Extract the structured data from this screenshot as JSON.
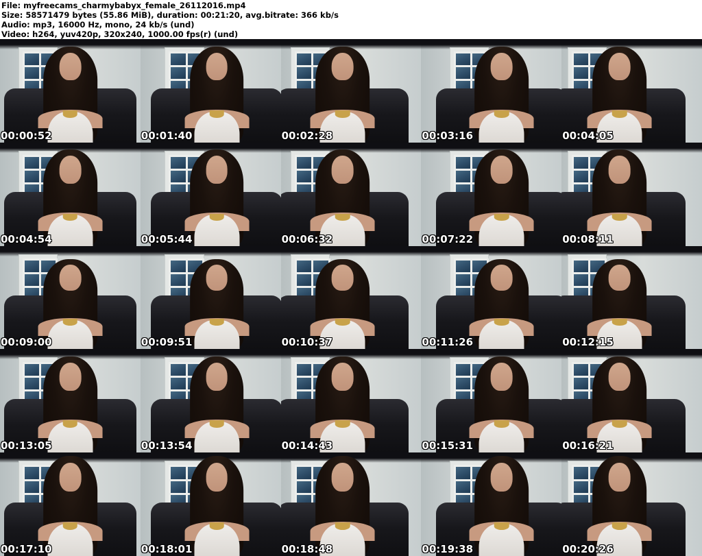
{
  "header": {
    "lines": [
      "File: myfreecams_charmybabyx_female_26112016.mp4",
      "Size: 58571479 bytes (55.86 MiB), duration: 00:21:20, avg.bitrate: 366 kb/s",
      "Audio: mp3, 16000 Hz, mono, 24 kb/s (und)",
      "Video: h264, yuv420p, 320x240, 1000.00 fps(r) (und)"
    ]
  },
  "thumbnails": {
    "rows": 5,
    "columns": 5,
    "timestamps": [
      "00:00:52",
      "00:01:40",
      "00:02:28",
      "00:03:16",
      "00:04:05",
      "00:04:54",
      "00:05:44",
      "00:06:32",
      "00:07:22",
      "00:08:11",
      "00:09:00",
      "00:09:51",
      "00:10:37",
      "00:11:26",
      "00:12:15",
      "00:13:05",
      "00:13:54",
      "00:14:43",
      "00:15:31",
      "00:16:21",
      "00:17:10",
      "00:18:01",
      "00:18:48",
      "00:19:38",
      "00:20:26"
    ]
  },
  "colors": {
    "header_bg": "#ffffff",
    "header_text": "#000000",
    "timestamp_text": "#ffffff",
    "timestamp_outline": "#000000",
    "window_pane": "#2e4d68",
    "wall": "#ccd2d2",
    "chair": "#17171b"
  }
}
